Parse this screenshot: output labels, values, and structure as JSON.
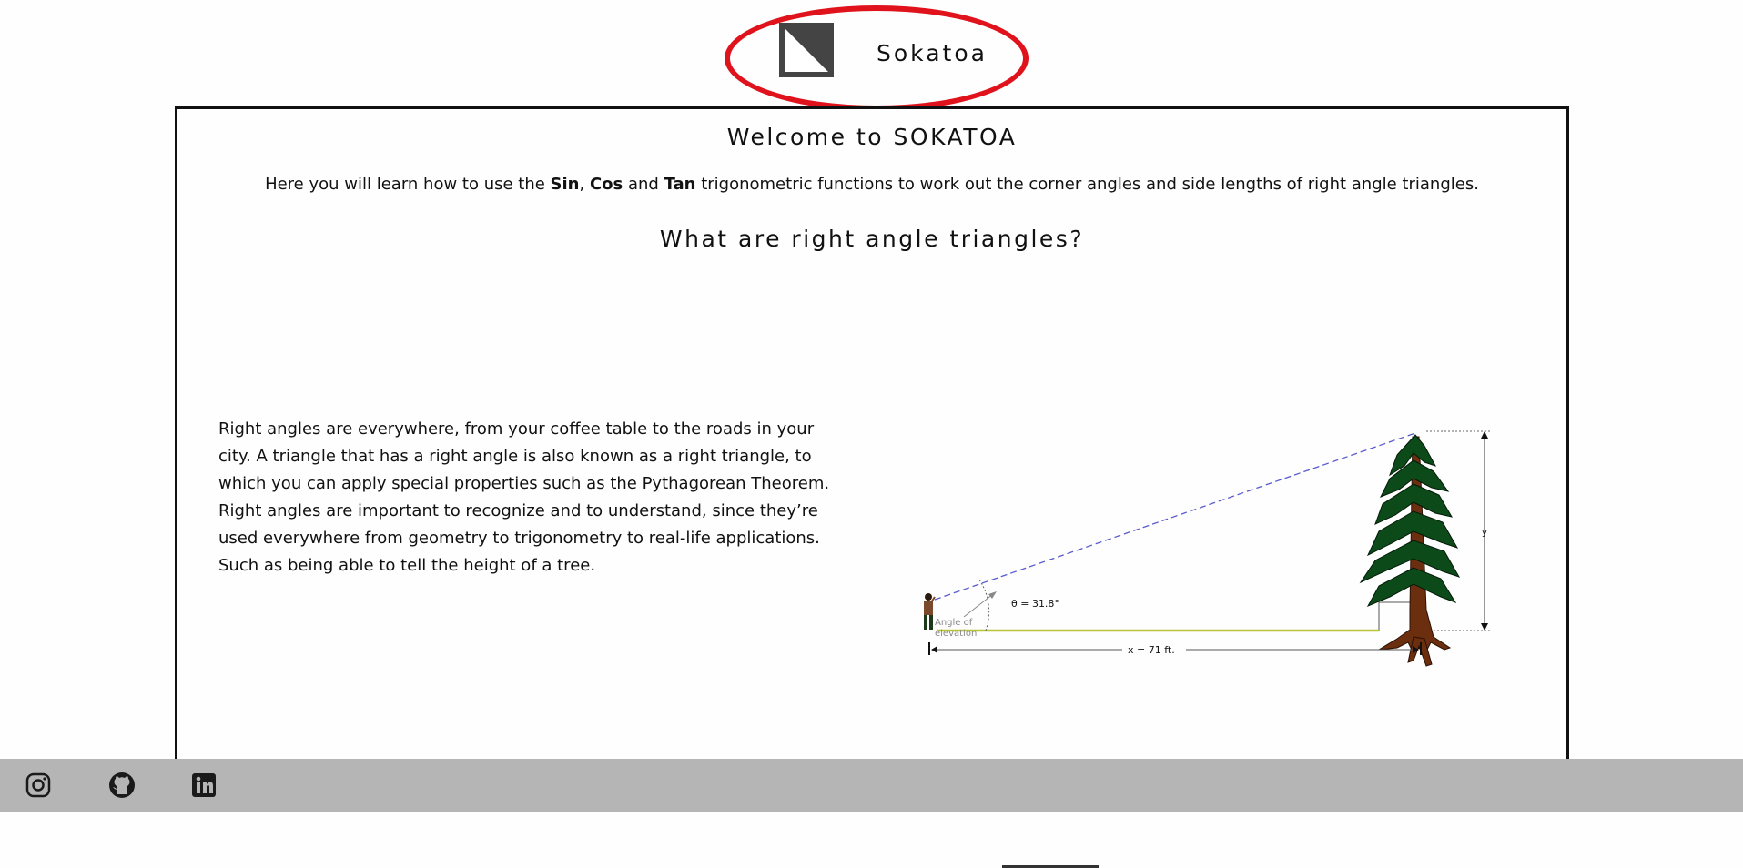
{
  "header": {
    "brand_name": "Sokatoa",
    "logo_icon": "sokatoa-triangle-logo-icon",
    "highlight_color": "#e0131d"
  },
  "main": {
    "welcome_title": "Welcome to SOKATOA",
    "intro": {
      "part1": "Here you will learn how to use the ",
      "sin": "Sin",
      "sep1": ", ",
      "cos": "Cos",
      "sep2": " and ",
      "tan": "Tan",
      "part2": " trigonometric functions to work out the corner angles and side lengths of right angle triangles."
    },
    "section_title": "What are right angle triangles?",
    "paragraph": "Right angles are everywhere, from your coffee table to the roads in your city. A triangle that has a right angle is also known as a right triangle, to which you can apply special properties such as the Pythagorean Theorem. Right angles are important to recognize and to understand, since they’re used everywhere from geometry to trigonometry to real-life applications. Such as being able to tell the height of a tree.",
    "diagram": {
      "angle_label": "θ = 31.8°",
      "elevation_label_line1": "Angle of",
      "elevation_label_line2": "elevation",
      "distance_label": "x = 71 ft.",
      "height_label": "y"
    }
  },
  "footer": {
    "icons": [
      "instagram-icon",
      "github-icon",
      "linkedin-icon"
    ],
    "background_color": "#b5b5b5"
  }
}
